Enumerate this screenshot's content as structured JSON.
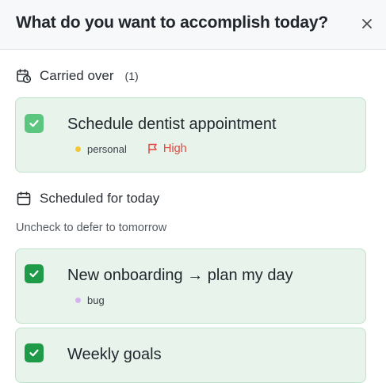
{
  "header": {
    "title": "What do you want to accomplish today?",
    "close_icon": "close-icon"
  },
  "carried_over": {
    "label": "Carried over",
    "count": "(1)",
    "icon": "calendar-clock-icon",
    "tasks": [
      {
        "title": "Schedule dentist appointment",
        "checked": true,
        "tag": "personal",
        "tag_color": "#f4c534",
        "priority": "High",
        "priority_color": "#e2463f"
      }
    ]
  },
  "scheduled": {
    "label": "Scheduled for today",
    "icon": "calendar-icon",
    "hint": "Uncheck to defer to tomorrow",
    "tasks": [
      {
        "title": "New onboarding → plan my day",
        "checked": true,
        "tag": "bug",
        "tag_color": "#d6b3f0"
      },
      {
        "title": "Weekly goals",
        "checked": true
      }
    ]
  },
  "colors": {
    "card_bg": "#e8f3ec",
    "card_border": "#bfe3ca",
    "check_light": "#5cc681",
    "check_dark": "#1e9a48"
  }
}
